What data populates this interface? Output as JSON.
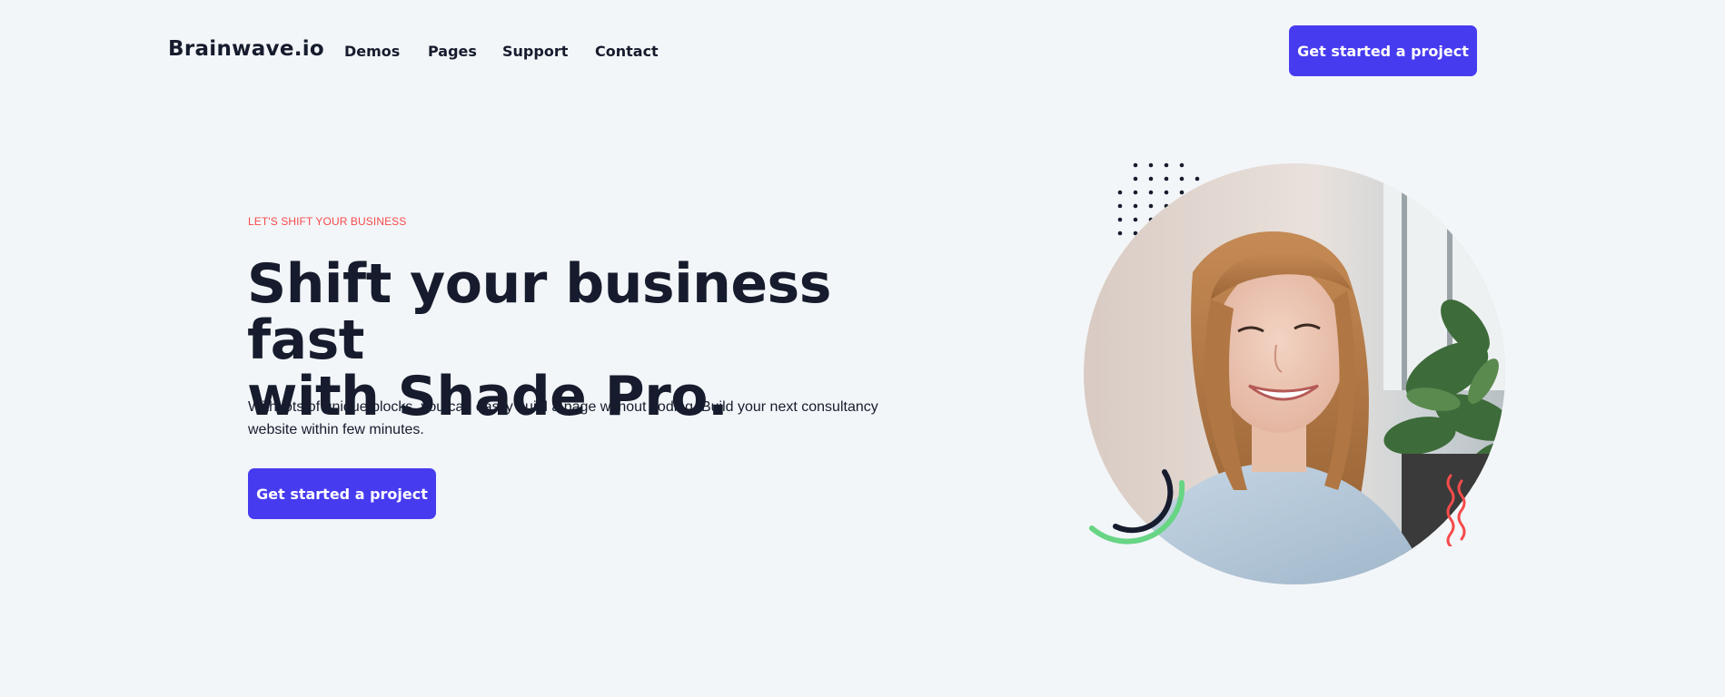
{
  "header": {
    "brand": "Brainwave.io",
    "nav": [
      "Demos",
      "Pages",
      "Support",
      "Contact"
    ],
    "cta_label": "Get started a project"
  },
  "hero": {
    "eyebrow": "LET'S SHIFT YOUR BUSINESS",
    "headline_line1": "Shift your business fast",
    "headline_line2": "with Shade Pro.",
    "lead": "With lots of unique blocks, you can easily build a page without coding. Build your next consultancy website within few minutes.",
    "cta_label": "Get started a project"
  },
  "colors": {
    "background": "#f3f6f9",
    "primary": "#473bf0",
    "heading": "#161c2d",
    "eyebrow": "#f64b4b",
    "accent_green": "#68d585",
    "accent_red": "#f64b4b"
  },
  "icons": {
    "dot_pattern": "dot-grid-pattern",
    "arc_decoration": "concentric-arcs-decoration",
    "squiggle_decoration": "wavy-lines-decoration"
  }
}
